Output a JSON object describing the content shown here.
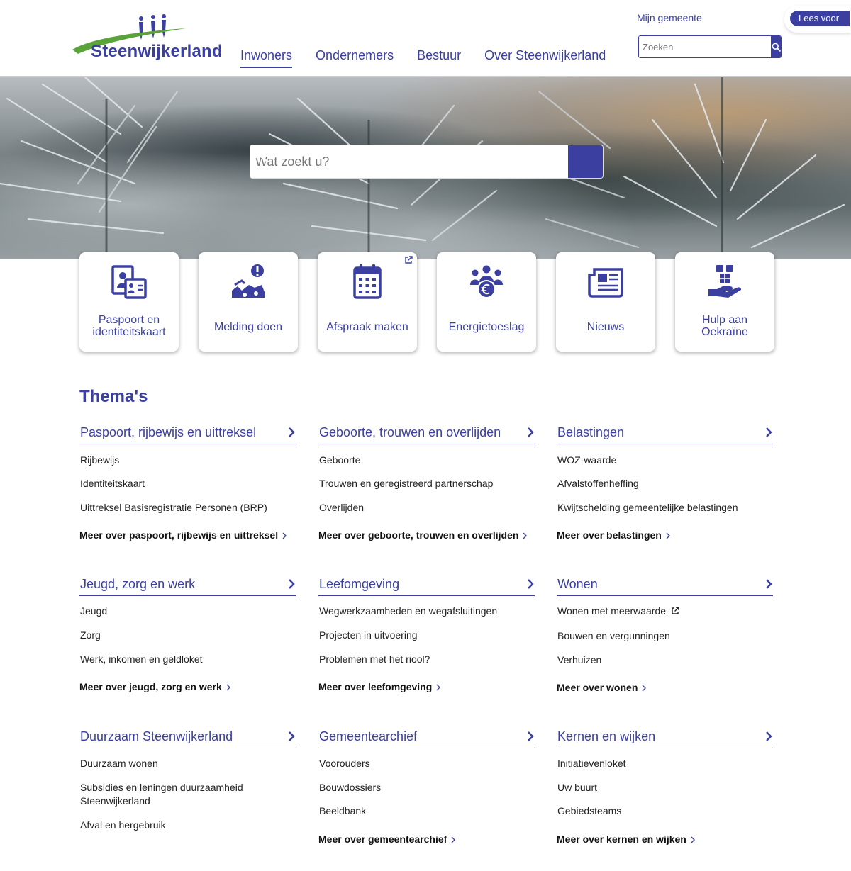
{
  "header": {
    "logo_text": "Steenwijkerland",
    "nav": [
      "Inwoners",
      "Ondernemers",
      "Bestuur",
      "Over Steenwijkerland"
    ],
    "mijn_gemeente": "Mijn gemeente",
    "search_placeholder": "Zoeken",
    "lees_voor": "Lees voor"
  },
  "hero": {
    "search_placeholder": "Wat zoekt u?"
  },
  "tiles": [
    {
      "label": "Paspoort en identiteitskaart",
      "icon": "passport-id-icon"
    },
    {
      "label": "Melding doen",
      "icon": "report-issue-icon"
    },
    {
      "label": "Afspraak maken",
      "icon": "calendar-icon",
      "external": true
    },
    {
      "label": "Energietoeslag",
      "icon": "group-euro-icon"
    },
    {
      "label": "Nieuws",
      "icon": "newspaper-icon"
    },
    {
      "label": "Hulp aan Oekraïne",
      "icon": "helping-hand-icon"
    }
  ],
  "themas": {
    "title": "Thema's",
    "items": [
      {
        "title": "Paspoort, rijbewijs en uittreksel",
        "links": [
          "Rijbewijs",
          "Identiteitskaart",
          "Uittreksel Basisregistratie Personen (BRP)"
        ],
        "meer": "Meer over paspoort, rijbewijs en uittreksel"
      },
      {
        "title": "Geboorte, trouwen en overlijden",
        "links": [
          "Geboorte",
          "Trouwen en geregistreerd partnerschap",
          "Overlijden"
        ],
        "meer": "Meer over geboorte, trouwen en overlijden"
      },
      {
        "title": "Belastingen",
        "links": [
          "WOZ-waarde",
          "Afvalstoffenheffing",
          "Kwijtschelding gemeentelijke belastingen"
        ],
        "meer": "Meer over belastingen"
      },
      {
        "title": "Jeugd, zorg en werk",
        "links": [
          "Jeugd",
          "Zorg",
          "Werk, inkomen en geldloket"
        ],
        "meer": "Meer over jeugd, zorg en werk"
      },
      {
        "title": "Leefomgeving",
        "links": [
          "Wegwerkzaamheden en wegafsluitingen",
          "Projecten in uitvoering",
          "Problemen met het riool?"
        ],
        "meer": "Meer over leefomgeving"
      },
      {
        "title": "Wonen",
        "links": [
          "Wonen met meerwaarde",
          "Bouwen en vergunningen",
          "Verhuizen"
        ],
        "meer": "Meer over wonen"
      },
      {
        "title": "Duurzaam Steenwijkerland",
        "links": [
          "Duurzaam wonen",
          "Subsidies en leningen duurzaamheid Steenwijkerland",
          "Afval en hergebruik"
        ],
        "meer": ""
      },
      {
        "title": "Gemeentearchief",
        "links": [
          "Voorouders",
          "Bouwdossiers",
          "Beeldbank"
        ],
        "meer": "Meer over gemeentearchief"
      },
      {
        "title": "Kernen en wijken",
        "links": [
          "Initiatievenloket",
          "Uw buurt",
          "Gebiedsteams"
        ],
        "meer": "Meer over kernen en wijken"
      }
    ]
  },
  "colors": {
    "brand": "#3a3fa0",
    "accent_green": "#5aa33a"
  }
}
